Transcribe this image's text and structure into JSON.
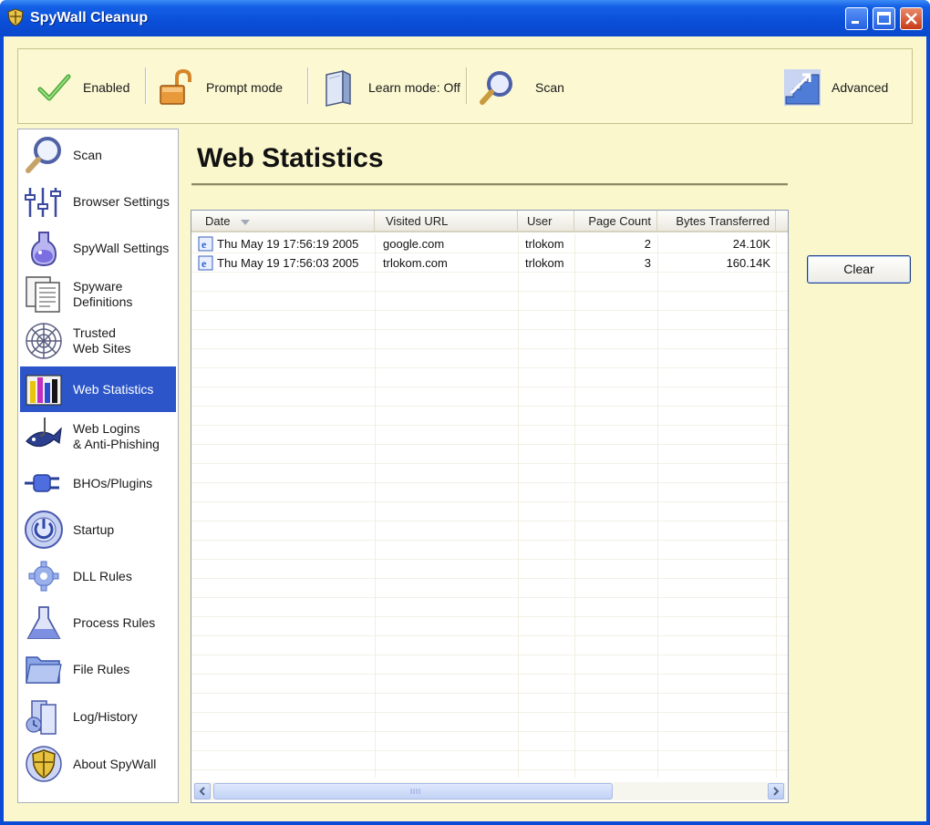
{
  "window": {
    "title": "SpyWall Cleanup"
  },
  "toolbar": {
    "items": [
      {
        "label": "Enabled",
        "icon": "checkmark-icon"
      },
      {
        "label": "Prompt mode",
        "icon": "unlocked-padlock-icon"
      },
      {
        "label": "Learn mode: Off",
        "icon": "book-icon"
      },
      {
        "label": "Scan",
        "icon": "magnifier-icon"
      },
      {
        "label": "Advanced",
        "icon": "stairs-arrow-icon"
      }
    ]
  },
  "sidebar": {
    "items": [
      {
        "label": "Scan",
        "icon": "magnifier-icon"
      },
      {
        "label": "Browser Settings",
        "icon": "sliders-icon"
      },
      {
        "label": "SpyWall Settings",
        "icon": "potion-icon"
      },
      {
        "label": "Spyware\nDefinitions",
        "icon": "documents-icon"
      },
      {
        "label": "Trusted\nWeb Sites",
        "icon": "web-icon"
      },
      {
        "label": "Web Statistics",
        "icon": "bar-chart-icon"
      },
      {
        "label": "Web Logins\n& Anti-Phishing",
        "icon": "fish-hook-icon"
      },
      {
        "label": "BHOs/Plugins",
        "icon": "plug-icon"
      },
      {
        "label": "Startup",
        "icon": "power-icon"
      },
      {
        "label": "DLL Rules",
        "icon": "gear-icon"
      },
      {
        "label": "Process Rules",
        "icon": "flask-icon"
      },
      {
        "label": "File Rules",
        "icon": "folder-icon"
      },
      {
        "label": "Log/History",
        "icon": "history-icon"
      },
      {
        "label": "About SpyWall",
        "icon": "shield-icon"
      }
    ],
    "active_index": 5
  },
  "main": {
    "title": "Web Statistics",
    "columns": [
      "Date",
      "Visited URL",
      "User",
      "Page Count",
      "Bytes Transferred"
    ],
    "rows": [
      {
        "date": "Thu May 19 17:56:19 2005",
        "url": "google.com",
        "user": "trlokom",
        "page_count": "2",
        "bytes": "24.10K"
      },
      {
        "date": "Thu May 19 17:56:03 2005",
        "url": "trlokom.com",
        "user": "trlokom",
        "page_count": "3",
        "bytes": "160.14K"
      }
    ],
    "clear_label": "Clear"
  },
  "colors": {
    "title_bar": "#0a4ed8",
    "client_bg": "#fbf7cd",
    "active_nav": "#2b55c8"
  }
}
